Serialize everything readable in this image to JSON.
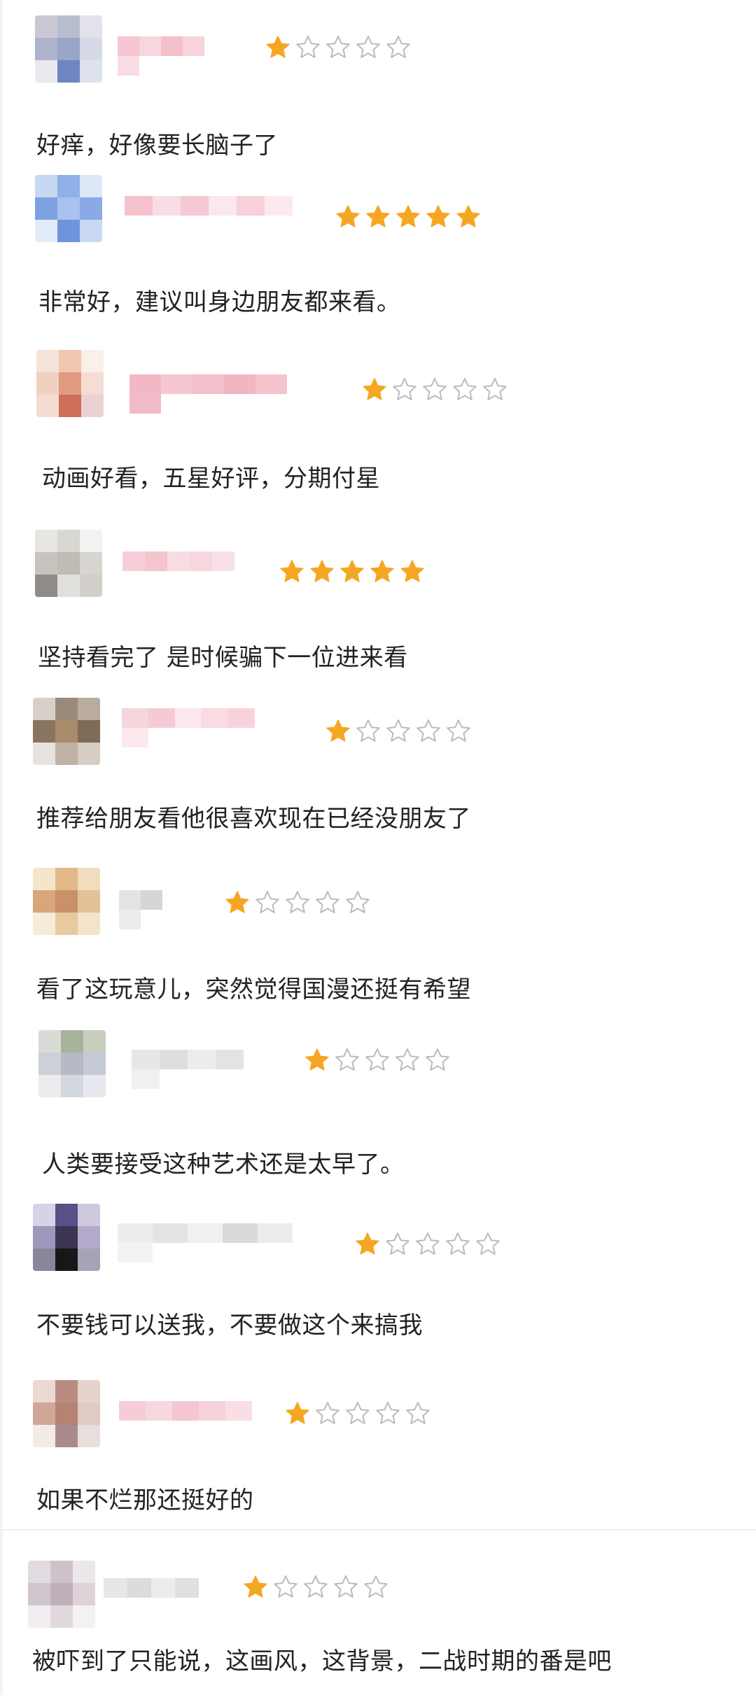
{
  "colors": {
    "star_filled": "#F5A623",
    "star_empty_stroke": "#BBBBBB",
    "text": "#222222",
    "background": "#FFFFFF"
  },
  "icons": {
    "filled_star": "filled-star-icon",
    "empty_star": "empty-star-icon"
  },
  "reviews": [
    {
      "rating": 1,
      "max_rating": 5,
      "comment": "好痒，好像要长脑子了"
    },
    {
      "rating": 5,
      "max_rating": 5,
      "comment": "非常好，建议叫身边朋友都来看。"
    },
    {
      "rating": 1,
      "max_rating": 5,
      "comment": "动画好看，五星好评，分期付星"
    },
    {
      "rating": 5,
      "max_rating": 5,
      "comment": "坚持看完了 是时候骗下一位进来看"
    },
    {
      "rating": 1,
      "max_rating": 5,
      "comment": "推荐给朋友看他很喜欢现在已经没朋友了"
    },
    {
      "rating": 1,
      "max_rating": 5,
      "comment": "看了这玩意儿，突然觉得国漫还挺有希望"
    },
    {
      "rating": 1,
      "max_rating": 5,
      "comment": "人类要接受这种艺术还是太早了。"
    },
    {
      "rating": 1,
      "max_rating": 5,
      "comment": "不要钱可以送我，不要做这个来搞我"
    },
    {
      "rating": 1,
      "max_rating": 5,
      "comment": "如果不烂那还挺好的"
    },
    {
      "rating": 1,
      "max_rating": 5,
      "comment": "被吓到了只能说，这画风，这背景，二战时期的番是吧"
    }
  ]
}
